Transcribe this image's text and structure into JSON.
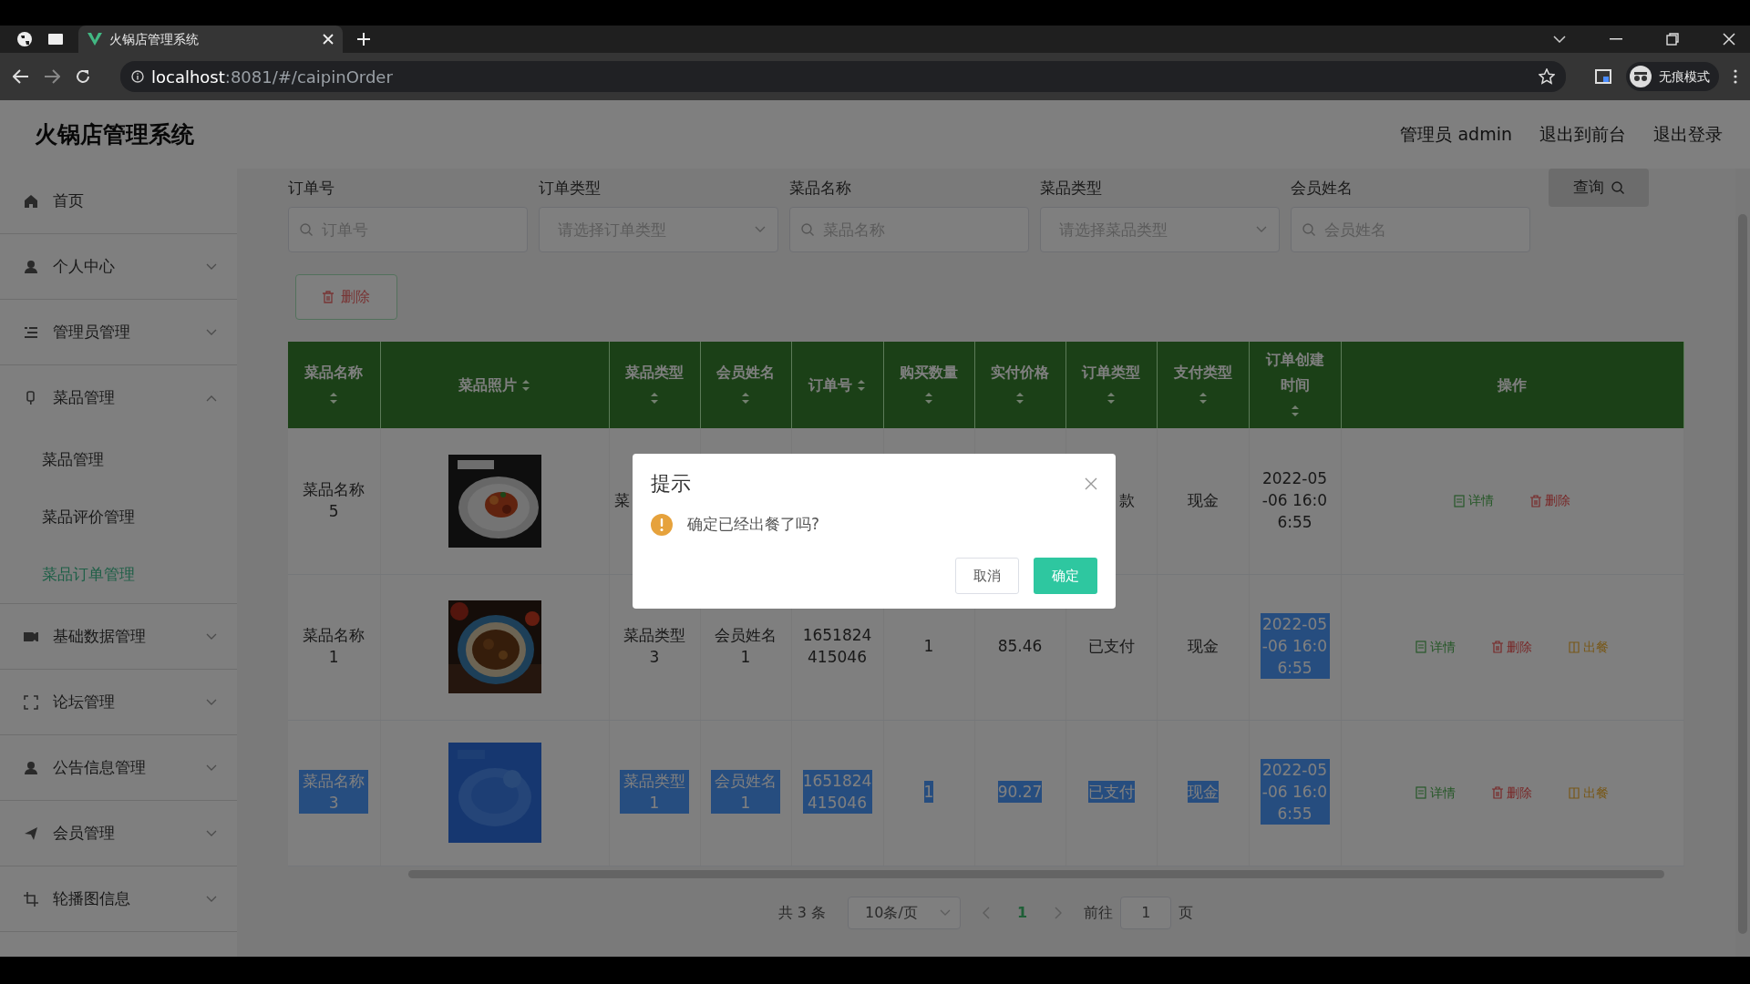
{
  "browser": {
    "tab_title": "火锅店管理系统",
    "url_host": "localhost",
    "url_rest": ":8081/#/caipinOrder",
    "profile": "无痕模式"
  },
  "header": {
    "title": "火锅店管理系统",
    "links": [
      "管理员 admin",
      "退出到前台",
      "退出登录"
    ]
  },
  "sidebar": {
    "items": [
      {
        "label": "首页",
        "kind": "link"
      },
      {
        "label": "个人中心",
        "kind": "menu",
        "expanded": false
      },
      {
        "label": "管理员管理",
        "kind": "menu",
        "expanded": false
      },
      {
        "label": "菜品管理",
        "kind": "menu",
        "expanded": true,
        "children": [
          {
            "label": "菜品管理",
            "selected": false
          },
          {
            "label": "菜品评价管理",
            "selected": false
          },
          {
            "label": "菜品订单管理",
            "selected": true
          }
        ]
      },
      {
        "label": "基础数据管理",
        "kind": "menu",
        "expanded": false
      },
      {
        "label": "论坛管理",
        "kind": "menu",
        "expanded": false
      },
      {
        "label": "公告信息管理",
        "kind": "menu",
        "expanded": false
      },
      {
        "label": "会员管理",
        "kind": "menu",
        "expanded": false
      },
      {
        "label": "轮播图信息",
        "kind": "menu",
        "expanded": false
      }
    ]
  },
  "filters": [
    {
      "label": "订单号",
      "placeholder": "订单号",
      "kind": "search"
    },
    {
      "label": "订单类型",
      "placeholder": "请选择订单类型",
      "kind": "select"
    },
    {
      "label": "菜品名称",
      "placeholder": "菜品名称",
      "kind": "search"
    },
    {
      "label": "菜品类型",
      "placeholder": "请选择菜品类型",
      "kind": "select"
    },
    {
      "label": "会员姓名",
      "placeholder": "会员姓名",
      "kind": "search"
    }
  ],
  "query_button": "查询",
  "delete_button": "删除",
  "table": {
    "columns": [
      {
        "label": "菜品名称",
        "sortable": true
      },
      {
        "label": "菜品照片",
        "sortable": true
      },
      {
        "label": "菜品类型",
        "sortable": true
      },
      {
        "label": "会员姓名",
        "sortable": true
      },
      {
        "label": "订单号",
        "sortable": true
      },
      {
        "label": "购买数量",
        "sortable": true
      },
      {
        "label": "实付价格",
        "sortable": true
      },
      {
        "label": "订单类型",
        "sortable": true
      },
      {
        "label": "支付类型",
        "sortable": true
      },
      {
        "label": "订单创建时间",
        "sortable": true
      },
      {
        "label": "操作",
        "sortable": false
      }
    ],
    "rows": [
      {
        "cells": [
          {
            "text": "菜品名称 5",
            "highlighted": false
          },
          {
            "kind": "picture",
            "highlighted": false
          },
          {
            "text": "菜",
            "highlighted": false,
            "clipped": true
          },
          null,
          null,
          null,
          null,
          {
            "text": "款",
            "highlighted": false,
            "clipped": true
          },
          {
            "text": "现金",
            "highlighted": false
          },
          {
            "text": "2022-05-06 16:06:55",
            "highlighted": false
          }
        ],
        "actions": [
          {
            "label": "详情",
            "kind": "detail"
          },
          {
            "label": "删除",
            "kind": "delete"
          }
        ]
      },
      {
        "cells": [
          {
            "text": "菜品名称 1",
            "highlighted": false
          },
          {
            "kind": "picture",
            "highlighted": false
          },
          {
            "text": "菜品类型 3",
            "highlighted": false
          },
          {
            "text": "会员姓名 1",
            "highlighted": false
          },
          {
            "text": "1651824415046",
            "highlighted": false
          },
          {
            "text": "1",
            "highlighted": false
          },
          {
            "text": "85.46",
            "highlighted": false
          },
          {
            "text": "已支付",
            "highlighted": false
          },
          {
            "text": "现金",
            "highlighted": false
          },
          {
            "text": "2022-05-06 16:06:55",
            "highlighted": true
          }
        ],
        "actions": [
          {
            "label": "详情",
            "kind": "detail"
          },
          {
            "label": "删除",
            "kind": "delete"
          },
          {
            "label": "出餐",
            "kind": "serve"
          }
        ]
      },
      {
        "cells": [
          {
            "text": "菜品名称 3",
            "highlighted": true
          },
          {
            "kind": "picture",
            "highlighted": true
          },
          {
            "text": "菜品类型 1",
            "highlighted": true
          },
          {
            "text": "会员姓名 1",
            "highlighted": true
          },
          {
            "text": "1651824415046",
            "highlighted": true
          },
          {
            "text": "1",
            "highlighted": true
          },
          {
            "text": "90.27",
            "highlighted": true
          },
          {
            "text": "已支付",
            "highlighted": true
          },
          {
            "text": "现金",
            "highlighted": true
          },
          {
            "text": "2022-05-06 16:06:55",
            "highlighted": true
          }
        ],
        "actions": [
          {
            "label": "详情",
            "kind": "detail"
          },
          {
            "label": "删除",
            "kind": "delete"
          },
          {
            "label": "出餐",
            "kind": "serve"
          }
        ]
      }
    ]
  },
  "pagination": {
    "total": "共 3 条",
    "page_size": "10条/页",
    "pages": [
      {
        "label": "1",
        "selected": true
      }
    ],
    "goto_label": "前往",
    "goto_value": "1",
    "goto_suffix": "页"
  },
  "dialog": {
    "title": "提示",
    "message": "确定已经出餐了吗?",
    "cancel": "取消",
    "confirm": "确定"
  }
}
